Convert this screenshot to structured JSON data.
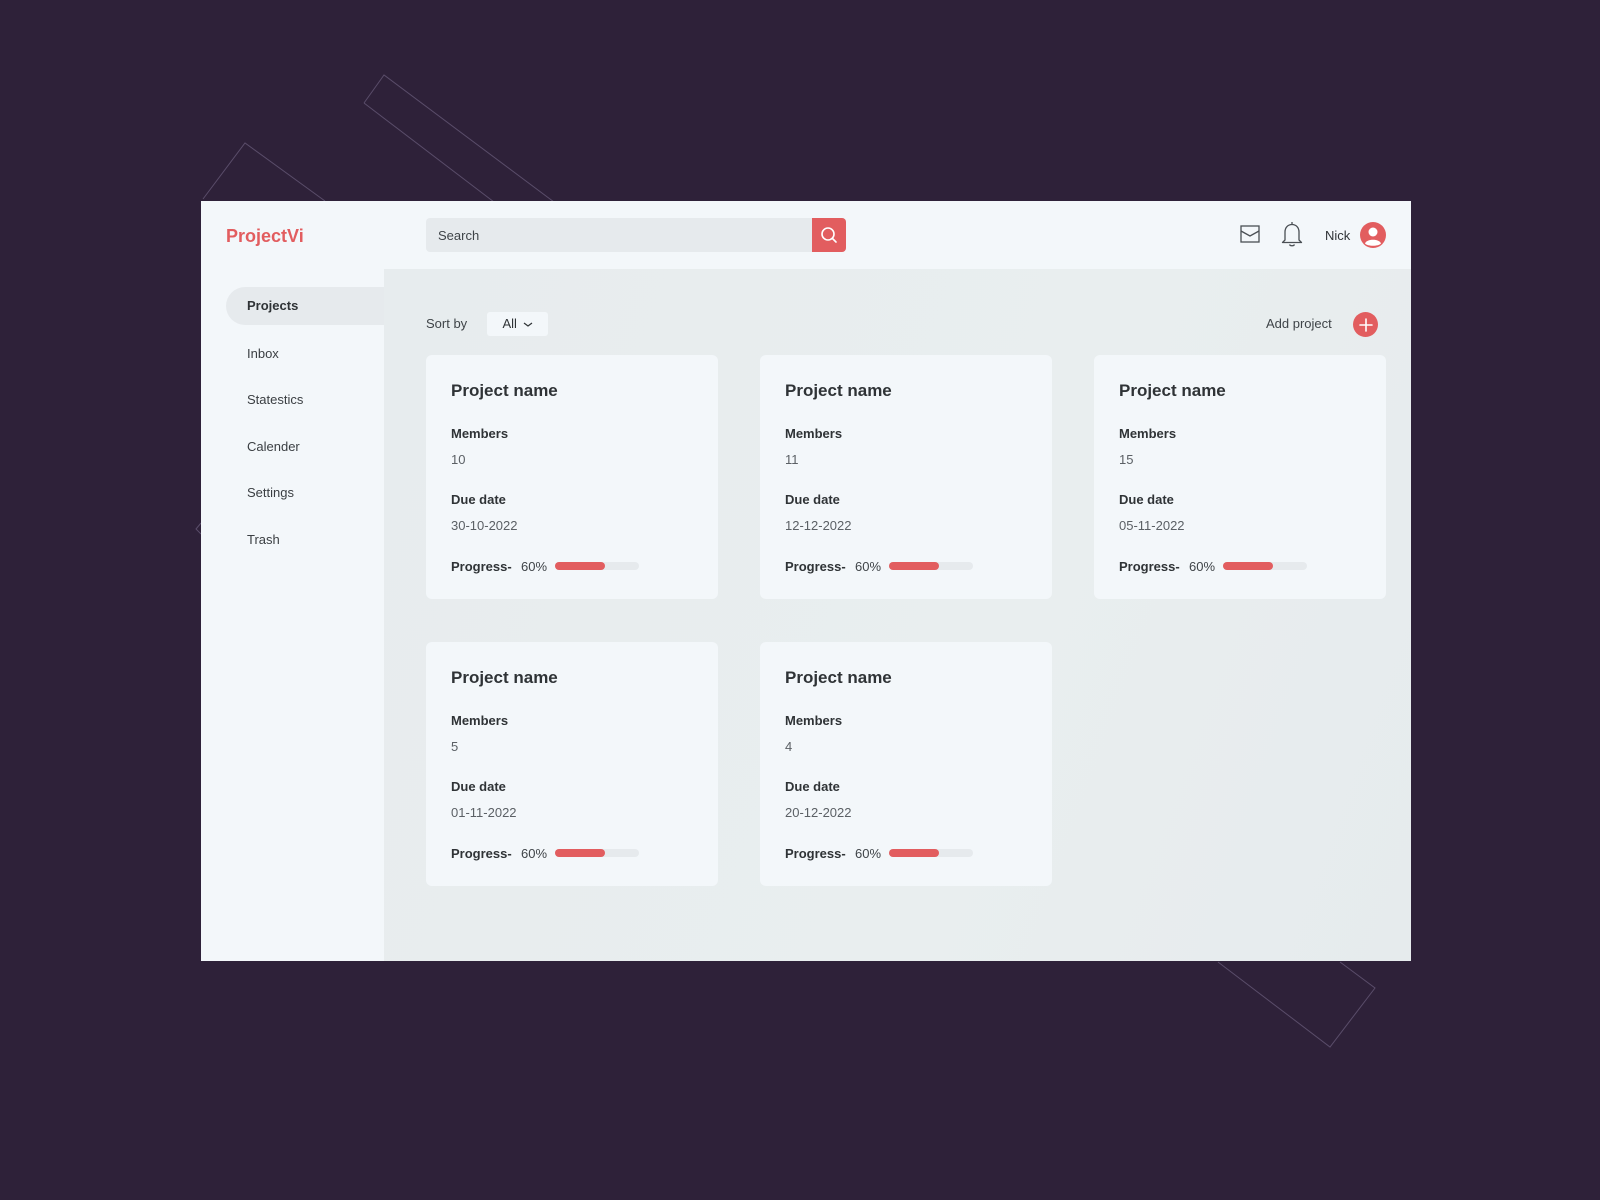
{
  "app": {
    "logo": "ProjectVi",
    "accent_color": "#e25d5f",
    "background_color": "#2e2139"
  },
  "header": {
    "search": {
      "placeholder": "Search",
      "icon": "search-icon"
    },
    "icons": [
      "mail-icon",
      "bell-icon"
    ],
    "user": {
      "name": "Nick",
      "icon": "user-avatar-icon"
    }
  },
  "sidebar": {
    "items": [
      {
        "label": "Projects",
        "active": true
      },
      {
        "label": "Inbox",
        "active": false
      },
      {
        "label": "Statestics",
        "active": false
      },
      {
        "label": "Calender",
        "active": false
      },
      {
        "label": "Settings",
        "active": false
      },
      {
        "label": "Trash",
        "active": false
      }
    ]
  },
  "toolbar": {
    "sort_label": "Sort by",
    "sort_value": "All",
    "sort_icon": "chevron-down-icon",
    "add_label": "Add project",
    "add_icon": "plus-icon"
  },
  "projects": [
    {
      "title": "Project name",
      "members_label": "Members",
      "members": "10",
      "due_label": "Due date",
      "due": "30-10-2022",
      "progress_label": "Progress-",
      "progress_text": "60%",
      "progress": 0.6
    },
    {
      "title": "Project name",
      "members_label": "Members",
      "members": "11",
      "due_label": "Due date",
      "due": "12-12-2022",
      "progress_label": "Progress-",
      "progress_text": "60%",
      "progress": 0.6
    },
    {
      "title": "Project name",
      "members_label": "Members",
      "members": "15",
      "due_label": "Due date",
      "due": "05-11-2022",
      "progress_label": "Progress-",
      "progress_text": "60%",
      "progress": 0.6
    },
    {
      "title": "Project name",
      "members_label": "Members",
      "members": "5",
      "due_label": "Due date",
      "due": "01-11-2022",
      "progress_label": "Progress-",
      "progress_text": "60%",
      "progress": 0.6
    },
    {
      "title": "Project name",
      "members_label": "Members",
      "members": "4",
      "due_label": "Due date",
      "due": "20-12-2022",
      "progress_label": "Progress-",
      "progress_text": "60%",
      "progress": 0.6
    }
  ]
}
